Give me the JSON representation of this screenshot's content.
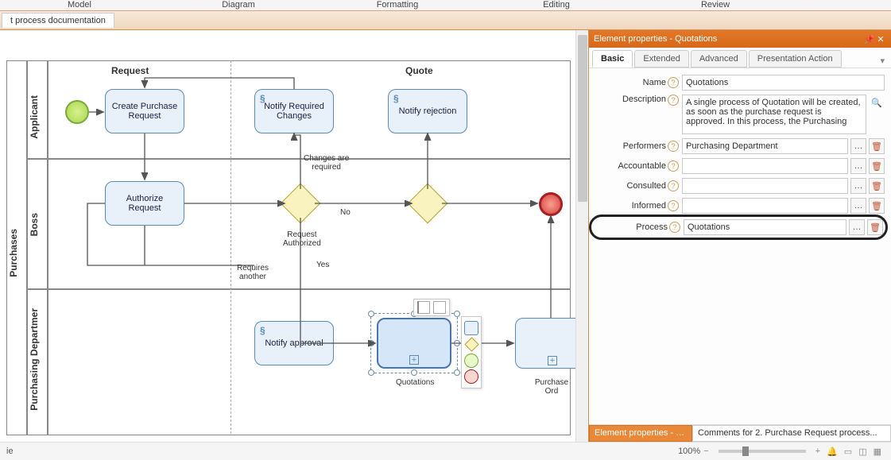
{
  "ribbon": {
    "tabs": [
      "Model",
      "Diagram",
      "Formatting",
      "Editing",
      "Review"
    ]
  },
  "docTab": "t process documentation",
  "phases": [
    "Request",
    "Quote"
  ],
  "pool": "Purchases",
  "lanes": [
    "Applicant",
    "Boss",
    "Purchasing Departmer"
  ],
  "tasks": {
    "createReq": "Create Purchase Request",
    "notifyChanges": "Notify Required Changes",
    "notifyReject": "Notify rejection",
    "authorize": "Authorize Request",
    "notifyApproval": "Notify approval",
    "quotations": "Quotations",
    "purchaseOrd": "Purchase Ord"
  },
  "edgeLabels": {
    "changesReq": "Changes are\nrequired",
    "reqAuth": "Request\nAuthorized",
    "no": "No",
    "yes": "Yes",
    "requiresAnother": "Requires\nanother"
  },
  "panel": {
    "title": "Element properties - Quotations",
    "tabs": [
      "Basic",
      "Extended",
      "Advanced",
      "Presentation Action"
    ],
    "fields": {
      "nameLabel": "Name",
      "nameVal": "Quotations",
      "descLabel": "Description",
      "descVal": "A single process of Quotation will be created, as soon as the purchase request is approved. In this process, the Purchasing",
      "perfLabel": "Performers",
      "perfVal": "Purchasing Department",
      "accLabel": "Accountable",
      "accVal": "",
      "consLabel": "Consulted",
      "consVal": "",
      "infLabel": "Informed",
      "infVal": "",
      "procLabel": "Process",
      "procVal": "Quotations"
    },
    "footerTab1": "Element properties - Qu...",
    "footerTab2": "Comments for 2. Purchase Request process..."
  },
  "status": {
    "zoom": "100%",
    "left": "ie"
  }
}
